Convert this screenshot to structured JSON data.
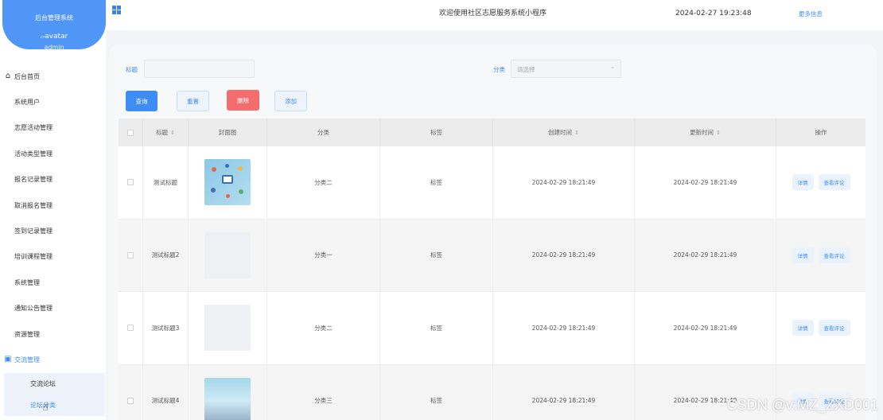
{
  "sidebar": {
    "brand_title": "后台管理系统",
    "avatar_alt": "avatar",
    "username": "admin",
    "items": [
      {
        "label": "后台首页",
        "icon": "home-icon"
      },
      {
        "label": "系统用户"
      },
      {
        "label": "志愿活动管理"
      },
      {
        "label": "活动类型管理"
      },
      {
        "label": "报名记录管理"
      },
      {
        "label": "取消报名管理"
      },
      {
        "label": "签到记录管理"
      },
      {
        "label": "培训课程管理"
      },
      {
        "label": "系统管理"
      },
      {
        "label": "通知公告管理"
      },
      {
        "label": "资源管理"
      },
      {
        "label": "交流管理",
        "icon": "forum-icon",
        "active": true
      }
    ],
    "sub_items": [
      "交流论坛",
      "论坛分类"
    ]
  },
  "header": {
    "welcome": "欢迎使用社区志愿服务系统小程序",
    "datetime": "2024-02-27 19:23:48",
    "more": "更多信息"
  },
  "search": {
    "title_label": "标题",
    "title_value": "",
    "category_label": "分类",
    "category_placeholder": "请选择"
  },
  "buttons": {
    "query": "查询",
    "reset": "重置",
    "delete": "删除",
    "add": "添加"
  },
  "table": {
    "columns": [
      "标题",
      "封面图",
      "分类",
      "标签",
      "创建时间",
      "更新时间",
      "操作"
    ],
    "rows": [
      {
        "title": "测试标题",
        "category": "分类二",
        "tag": "标签",
        "created": "2024-02-29 18:21:49",
        "updated": "2024-02-29 18:21:49",
        "cover": "illustration"
      },
      {
        "title": "测试标题2",
        "category": "分类一",
        "tag": "标签",
        "created": "2024-02-29 18:21:49",
        "updated": "2024-02-29 18:21:49",
        "cover": "blank"
      },
      {
        "title": "测试标题3",
        "category": "分类二",
        "tag": "标签",
        "created": "2024-02-29 18:21:49",
        "updated": "2024-02-29 18:21:49",
        "cover": "blank"
      },
      {
        "title": "测试标题4",
        "category": "分类三",
        "tag": "标签",
        "created": "2024-02-29 18:21:49",
        "updated": "2024-02-29 18:21:49",
        "cover": "illustration"
      }
    ],
    "actions": {
      "detail": "详情",
      "comments": "查看评论"
    }
  },
  "watermark": "CSDN @v:MZ_ZXD001",
  "colors": {
    "primary": "#3d8df5",
    "danger": "#f56c6c",
    "brand": "#4f96f7"
  }
}
